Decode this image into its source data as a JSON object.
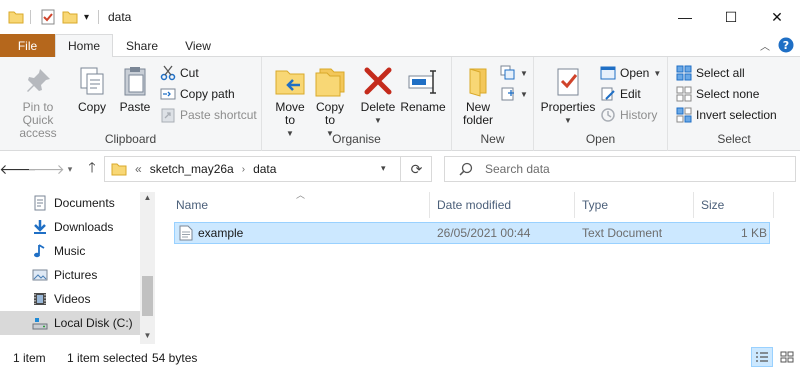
{
  "window": {
    "title": "data",
    "controls": {
      "minimize": "—",
      "maximize": "☐",
      "close": "✕"
    }
  },
  "ribbon_tabs": [
    {
      "label": "File"
    },
    {
      "label": "Home"
    },
    {
      "label": "Share"
    },
    {
      "label": "View"
    }
  ],
  "ribbon": {
    "clipboard": {
      "label": "Clipboard",
      "pin": "Pin to Quick access",
      "copy": "Copy",
      "paste": "Paste",
      "cut": "Cut",
      "copy_path": "Copy path",
      "paste_shortcut": "Paste shortcut"
    },
    "organise": {
      "label": "Organise",
      "move_to": "Move to",
      "copy_to": "Copy to",
      "delete": "Delete",
      "rename": "Rename"
    },
    "new": {
      "label": "New",
      "new_folder": "New folder"
    },
    "open": {
      "label": "Open",
      "properties": "Properties",
      "open": "Open",
      "edit": "Edit",
      "history": "History"
    },
    "select": {
      "label": "Select",
      "select_all": "Select all",
      "select_none": "Select none",
      "invert": "Invert selection"
    }
  },
  "address": {
    "overflow": "«",
    "crumbs": [
      "sketch_may26a",
      "data"
    ],
    "search_placeholder": "Search data"
  },
  "nav_pane": {
    "items": [
      {
        "label": "Documents",
        "icon": "documents-icon"
      },
      {
        "label": "Downloads",
        "icon": "downloads-icon"
      },
      {
        "label": "Music",
        "icon": "music-icon"
      },
      {
        "label": "Pictures",
        "icon": "pictures-icon"
      },
      {
        "label": "Videos",
        "icon": "videos-icon"
      },
      {
        "label": "Local Disk (C:)",
        "icon": "drive-icon"
      }
    ]
  },
  "file_list": {
    "columns": [
      "Name",
      "Date modified",
      "Type",
      "Size"
    ],
    "rows": [
      {
        "name": "example",
        "date": "26/05/2021 00:44",
        "type": "Text Document",
        "size": "1 KB"
      }
    ]
  },
  "status": {
    "item_count": "1 item",
    "selection": "1 item selected",
    "size": "54 bytes"
  },
  "colors": {
    "file_tab": "#b5671c",
    "selection_bg": "#cce8ff",
    "selection_border": "#99d1ff",
    "header_text": "#4c607a"
  }
}
